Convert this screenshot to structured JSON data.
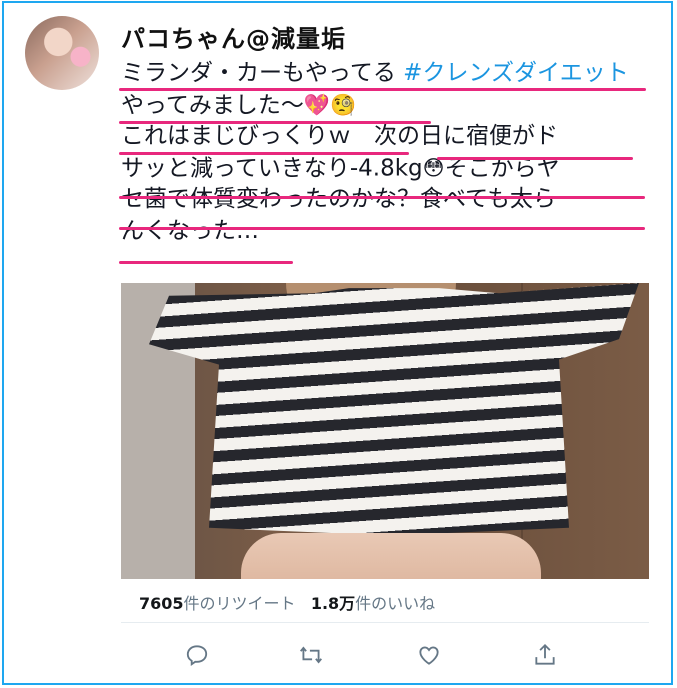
{
  "tweet": {
    "author_name": "パコちゃん@減量垢",
    "lines": [
      {
        "parts": [
          {
            "text": "ミランダ・カーもやってる ",
            "type": "text"
          },
          {
            "text": "#クレンズダイエット",
            "type": "hashtag"
          }
        ]
      },
      {
        "parts": [
          {
            "text": "やってみました〜",
            "type": "text"
          },
          {
            "text": "💖🧐",
            "type": "emoji"
          }
        ]
      },
      {
        "parts": [
          {
            "text": "これはまじびっくりｗ　次の日に宿便がド",
            "type": "text"
          }
        ]
      },
      {
        "parts": [
          {
            "text": "サッと減っていきなり-4.8kg",
            "type": "text"
          },
          {
            "text": "😳",
            "type": "emoji"
          },
          {
            "text": "そこからヤ",
            "type": "text"
          }
        ]
      },
      {
        "parts": [
          {
            "text": "セ菌で体質変わったのかな？食べても太ら",
            "type": "text"
          }
        ]
      },
      {
        "parts": [
          {
            "text": "んくなった…",
            "type": "text"
          }
        ]
      }
    ],
    "retweet_count": "7605",
    "retweet_label": "件のリツイート",
    "like_count": "1.8万",
    "like_label": "件のいいね"
  },
  "colors": {
    "border": "#1ea7f0",
    "underline": "#e8287d",
    "hashtag": "#1b95e0",
    "icon": "#657786"
  },
  "icons": [
    "reply-icon",
    "retweet-icon",
    "like-icon",
    "share-icon"
  ]
}
